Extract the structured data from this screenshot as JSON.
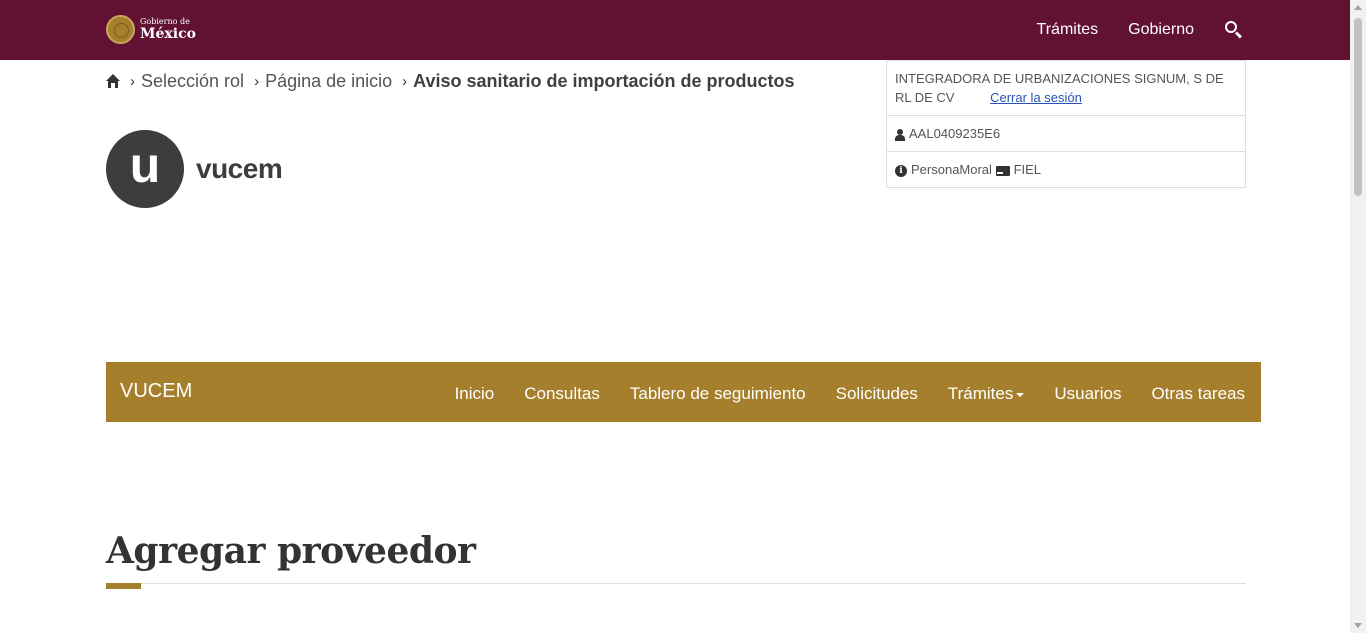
{
  "gov_header": {
    "logo_small": "Gobierno de",
    "logo_big": "México",
    "nav": [
      "Trámites",
      "Gobierno"
    ]
  },
  "breadcrumb": {
    "items": [
      "Selección rol",
      "Página de inicio"
    ],
    "current": "Aviso sanitario de importación de productos"
  },
  "user": {
    "company": "INTEGRADORA DE URBANIZACIONES SIGNUM, S DE RL DE CV",
    "logout": "Cerrar la sesión",
    "rfc": "AAL0409235E6",
    "person_type": "PersonaMoral",
    "auth_method": "FIEL"
  },
  "logo": {
    "letter": "u",
    "word": "vucem"
  },
  "navbar": {
    "brand": "VUCEM",
    "items": [
      "Inicio",
      "Consultas",
      "Tablero de seguimiento",
      "Solicitudes",
      "Trámites",
      "Usuarios",
      "Otras tareas"
    ]
  },
  "page": {
    "title": "Agregar proveedor"
  },
  "colors": {
    "gov_bar": "#611232",
    "accent": "#a57f2c"
  }
}
